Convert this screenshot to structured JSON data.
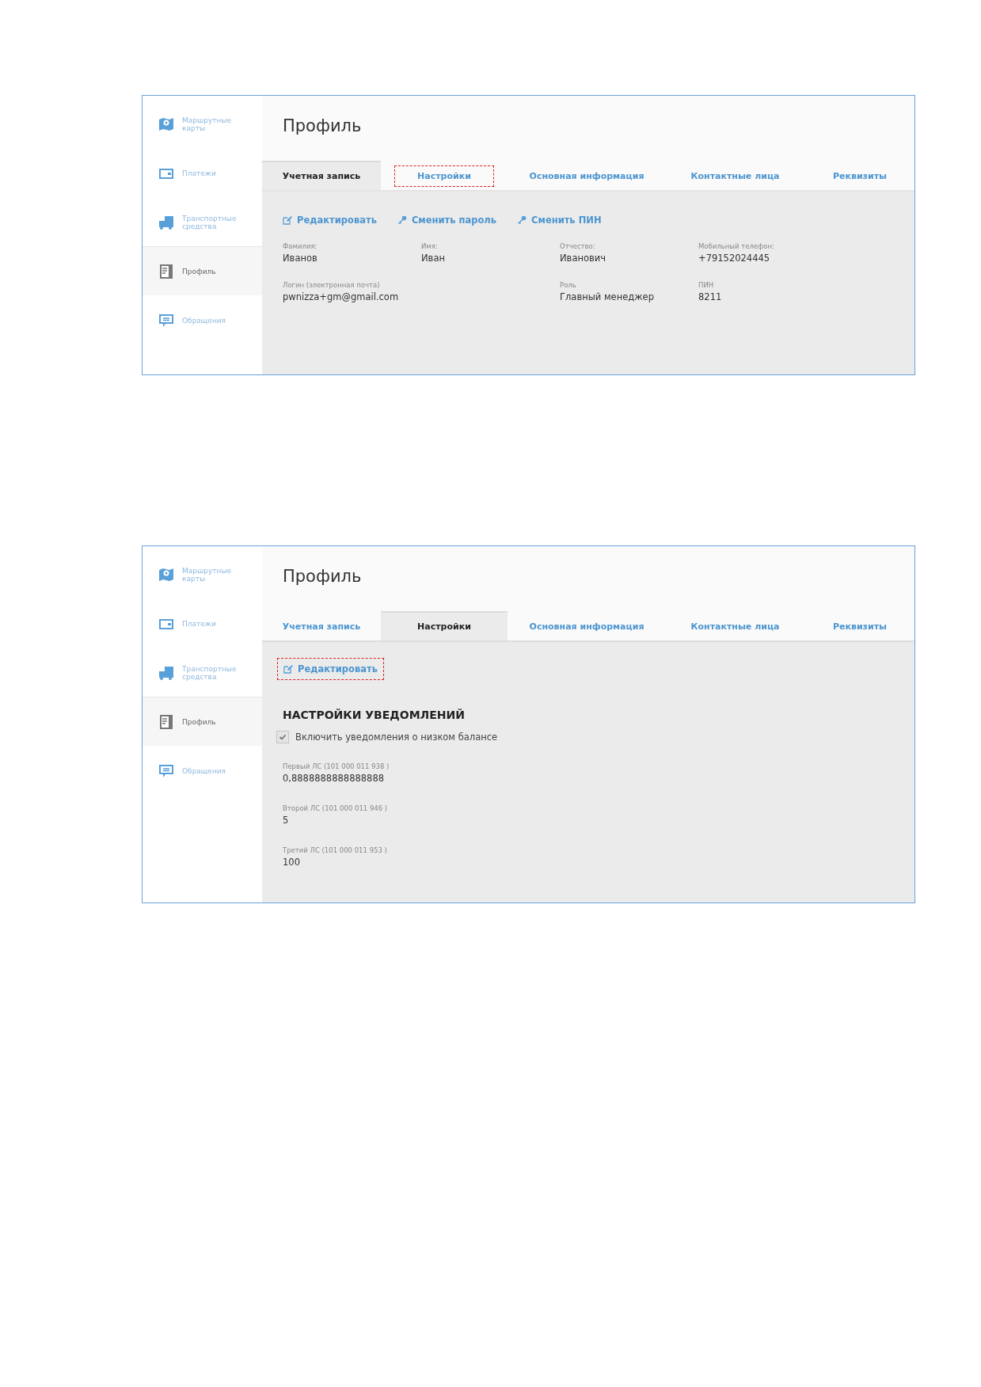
{
  "screens": [
    {
      "kind": "account",
      "sidebar": [
        {
          "label": "Маршрутные карты",
          "kind": "map",
          "selected": false
        },
        {
          "label": "Платежи",
          "kind": "wallet",
          "selected": false
        },
        {
          "label": "Транспортные средства",
          "kind": "truck",
          "selected": false
        },
        {
          "label": "Профиль",
          "kind": "document",
          "selected": true
        },
        {
          "label": "Обращения",
          "kind": "chat",
          "selected": false
        }
      ],
      "title": "Профиль",
      "tabs": [
        {
          "label": "Учетная запись",
          "selected": true,
          "highlighted": false
        },
        {
          "label": "Настройки",
          "selected": false,
          "highlighted": true
        },
        {
          "label": "Основная информация",
          "selected": false,
          "highlighted": false
        },
        {
          "label": "Контактные лица",
          "selected": false,
          "highlighted": false
        },
        {
          "label": "Реквизиты",
          "selected": false,
          "highlighted": false
        }
      ],
      "actions": [
        {
          "label": "Редактировать",
          "kind": "edit",
          "highlighted": false
        },
        {
          "label": "Сменить пароль",
          "kind": "key",
          "highlighted": false
        },
        {
          "label": "Сменить ПИН",
          "kind": "key",
          "highlighted": false
        }
      ],
      "fields": [
        {
          "label": "Фамилия:",
          "value": "Иванов",
          "wide": false
        },
        {
          "label": "Имя:",
          "value": "Иван",
          "wide": false
        },
        {
          "label": "Отчество:",
          "value": "Иванович",
          "wide": false
        },
        {
          "label": "Мобильный телефон:",
          "value": "+79152024445",
          "wide": false
        },
        {
          "label": "Логин (электронная почта)",
          "value": "pwnizza+gm@gmail.com",
          "wide": true
        },
        {
          "label": "Роль",
          "value": "Главный менеджер",
          "wide": false
        },
        {
          "label": "ПИН",
          "value": "8211",
          "wide": false
        }
      ]
    },
    {
      "kind": "settings",
      "sidebar": [
        {
          "label": "Маршрутные карты",
          "kind": "map",
          "selected": false
        },
        {
          "label": "Платежи",
          "kind": "wallet",
          "selected": false
        },
        {
          "label": "Транспортные средства",
          "kind": "truck",
          "selected": false
        },
        {
          "label": "Профиль",
          "kind": "document",
          "selected": true
        },
        {
          "label": "Обращения",
          "kind": "chat",
          "selected": false
        }
      ],
      "title": "Профиль",
      "tabs": [
        {
          "label": "Учетная запись",
          "selected": false,
          "highlighted": false
        },
        {
          "label": "Настройки",
          "selected": true,
          "highlighted": false
        },
        {
          "label": "Основная информация",
          "selected": false,
          "highlighted": false
        },
        {
          "label": "Контактные лица",
          "selected": false,
          "highlighted": false
        },
        {
          "label": "Реквизиты",
          "selected": false,
          "highlighted": false
        }
      ],
      "actions": [
        {
          "label": "Редактировать",
          "kind": "edit",
          "highlighted": true
        }
      ],
      "section_title": "НАСТРОЙКИ УВЕДОМЛЕНИЙ",
      "checkbox": {
        "label": "Включить уведомления о низком балансе",
        "checked": true,
        "disabled": true
      },
      "thresholds": [
        {
          "label": "Первый ЛС (101 000 011 938 )",
          "value": "0,8888888888888888"
        },
        {
          "label": "Второй ЛС (101 000 011 946 )",
          "value": "5"
        },
        {
          "label": "Третий ЛС (101 000 011 953 )",
          "value": "100"
        }
      ]
    }
  ]
}
